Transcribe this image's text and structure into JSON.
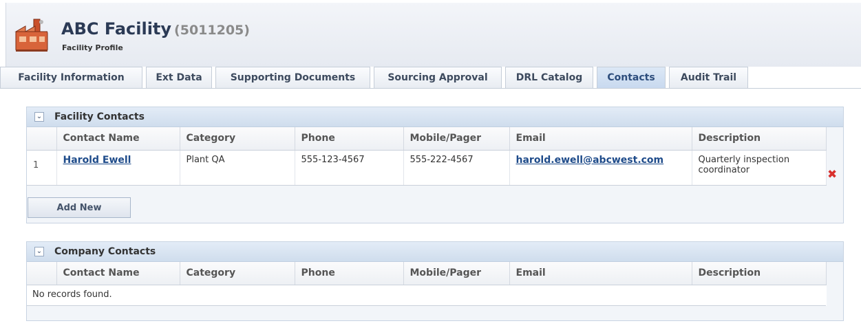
{
  "header": {
    "title": "ABC Facility",
    "facility_id": "(5011205)",
    "subtitle": "Facility Profile",
    "icon": "factory-icon"
  },
  "tabs": [
    {
      "label": "Facility Information",
      "active": false
    },
    {
      "label": "Ext Data",
      "active": false
    },
    {
      "label": "Supporting Documents",
      "active": false
    },
    {
      "label": "Sourcing Approval",
      "active": false
    },
    {
      "label": "DRL Catalog",
      "active": false
    },
    {
      "label": "Contacts",
      "active": true
    },
    {
      "label": "Audit Trail",
      "active": false
    }
  ],
  "facility_contacts": {
    "title": "Facility Contacts",
    "columns": [
      "Contact Name",
      "Category",
      "Phone",
      "Mobile/Pager",
      "Email",
      "Description"
    ],
    "rows": [
      {
        "num": "1",
        "name": "Harold Ewell",
        "category": "Plant QA",
        "phone": "555-123-4567",
        "mobile": "555-222-4567",
        "email": "harold.ewell@abcwest.com",
        "description": "Quarterly inspection coordinator"
      }
    ],
    "add_button": "Add New"
  },
  "company_contacts": {
    "title": "Company Contacts",
    "columns": [
      "Contact Name",
      "Category",
      "Phone",
      "Mobile/Pager",
      "Email",
      "Description"
    ],
    "empty_text": "No records found."
  },
  "colors": {
    "accent": "#2d4d7c",
    "delete": "#d9302d",
    "link": "#1e4b8a"
  }
}
